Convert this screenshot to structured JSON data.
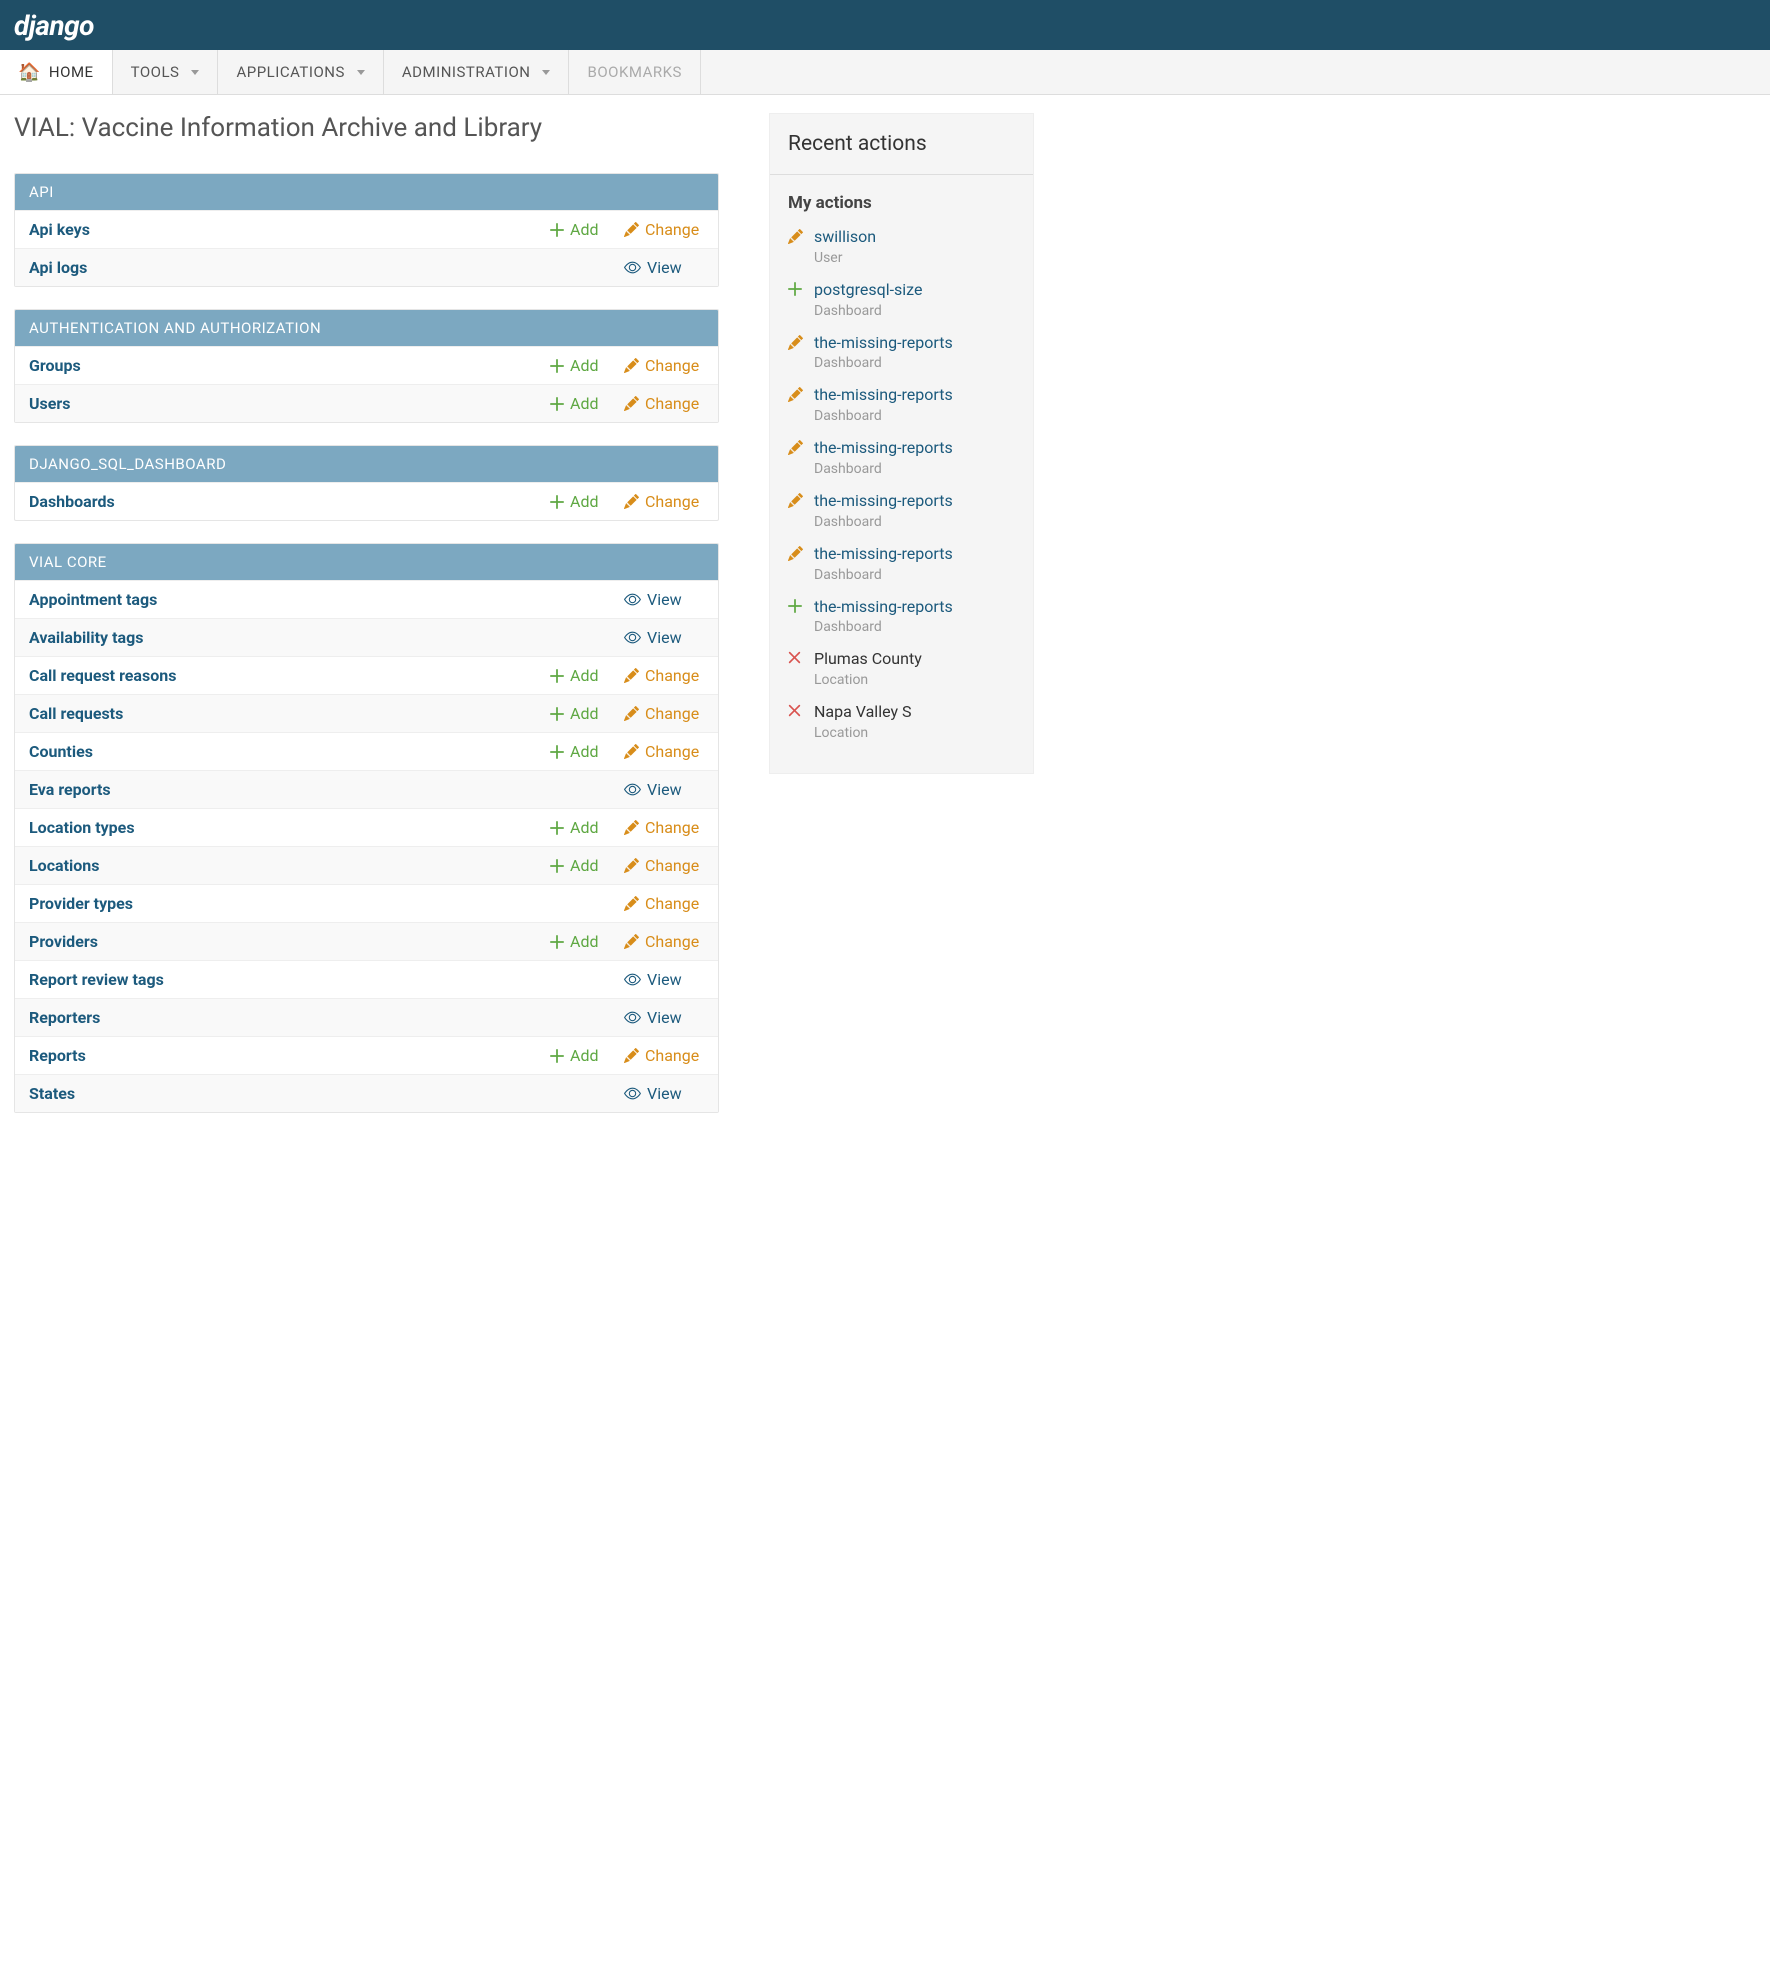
{
  "header": {
    "logo": "django"
  },
  "nav": {
    "home": "HOME",
    "tools": "TOOLS",
    "applications": "APPLICATIONS",
    "administration": "ADMINISTRATION",
    "bookmarks": "BOOKMARKS"
  },
  "page_title": "VIAL: Vaccine Information Archive and Library",
  "labels": {
    "add": "Add",
    "change": "Change",
    "view": "View"
  },
  "sections": [
    {
      "title": "API",
      "models": [
        {
          "name": "Api keys",
          "add": true,
          "change": true,
          "view": false
        },
        {
          "name": "Api logs",
          "add": false,
          "change": false,
          "view": true
        }
      ]
    },
    {
      "title": "AUTHENTICATION AND AUTHORIZATION",
      "models": [
        {
          "name": "Groups",
          "add": true,
          "change": true,
          "view": false
        },
        {
          "name": "Users",
          "add": true,
          "change": true,
          "view": false
        }
      ]
    },
    {
      "title": "DJANGO_SQL_DASHBOARD",
      "models": [
        {
          "name": "Dashboards",
          "add": true,
          "change": true,
          "view": false
        }
      ]
    },
    {
      "title": "VIAL CORE",
      "models": [
        {
          "name": "Appointment tags",
          "add": false,
          "change": false,
          "view": true
        },
        {
          "name": "Availability tags",
          "add": false,
          "change": false,
          "view": true
        },
        {
          "name": "Call request reasons",
          "add": true,
          "change": true,
          "view": false
        },
        {
          "name": "Call requests",
          "add": true,
          "change": true,
          "view": false
        },
        {
          "name": "Counties",
          "add": true,
          "change": true,
          "view": false
        },
        {
          "name": "Eva reports",
          "add": false,
          "change": false,
          "view": true
        },
        {
          "name": "Location types",
          "add": true,
          "change": true,
          "view": false
        },
        {
          "name": "Locations",
          "add": true,
          "change": true,
          "view": false
        },
        {
          "name": "Provider types",
          "add": false,
          "change": true,
          "view": false
        },
        {
          "name": "Providers",
          "add": true,
          "change": true,
          "view": false
        },
        {
          "name": "Report review tags",
          "add": false,
          "change": false,
          "view": true
        },
        {
          "name": "Reporters",
          "add": false,
          "change": false,
          "view": true
        },
        {
          "name": "Reports",
          "add": true,
          "change": true,
          "view": false
        },
        {
          "name": "States",
          "add": false,
          "change": false,
          "view": true
        }
      ]
    }
  ],
  "recent": {
    "title": "Recent actions",
    "my_actions": "My actions",
    "items": [
      {
        "icon": "pencil",
        "name": "swillison",
        "type": "User",
        "deleted": false
      },
      {
        "icon": "plus",
        "name": "postgresql-size",
        "type": "Dashboard",
        "deleted": false
      },
      {
        "icon": "pencil",
        "name": "the-missing-reports",
        "type": "Dashboard",
        "deleted": false
      },
      {
        "icon": "pencil",
        "name": "the-missing-reports",
        "type": "Dashboard",
        "deleted": false
      },
      {
        "icon": "pencil",
        "name": "the-missing-reports",
        "type": "Dashboard",
        "deleted": false
      },
      {
        "icon": "pencil",
        "name": "the-missing-reports",
        "type": "Dashboard",
        "deleted": false
      },
      {
        "icon": "pencil",
        "name": "the-missing-reports",
        "type": "Dashboard",
        "deleted": false
      },
      {
        "icon": "plus",
        "name": "the-missing-reports",
        "type": "Dashboard",
        "deleted": false
      },
      {
        "icon": "x",
        "name": "Plumas County",
        "type": "Location",
        "deleted": true
      },
      {
        "icon": "x",
        "name": "Napa Valley S",
        "type": "Location",
        "deleted": true
      }
    ]
  }
}
